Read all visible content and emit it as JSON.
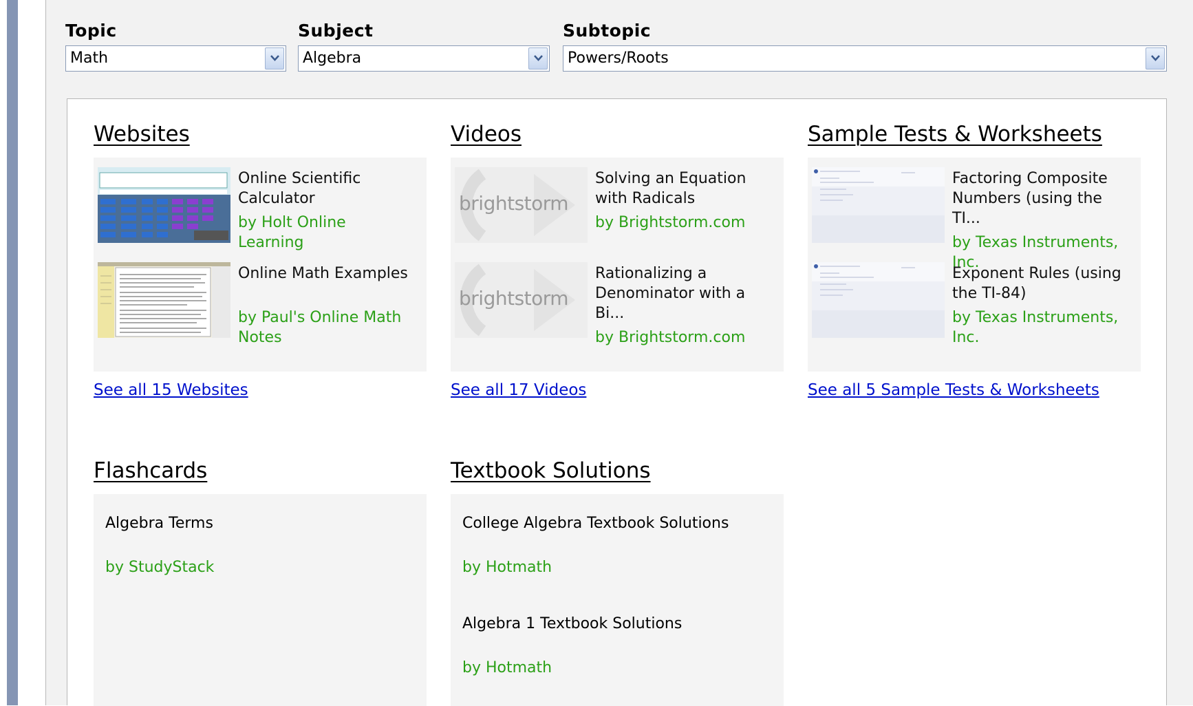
{
  "filters": {
    "topic": {
      "label": "Topic",
      "value": "Math"
    },
    "subject": {
      "label": "Subject",
      "value": "Algebra"
    },
    "subtopic": {
      "label": "Subtopic",
      "value": "Powers/Roots"
    }
  },
  "websites": {
    "title": "Websites",
    "items": [
      {
        "title": "Online Scientific Calculator",
        "author": "by Holt Online Learning"
      },
      {
        "title": "Online Math Examples",
        "author": "by Paul's Online Math Notes"
      }
    ],
    "see_all": "See all 15 Websites"
  },
  "videos": {
    "title": "Videos",
    "items": [
      {
        "title": "Solving an Equation with Radicals",
        "author": "by Brightstorm.com",
        "thumb_text": "brightstorm"
      },
      {
        "title": "Rationalizing a Denominator with a Bi...",
        "author": "by Brightstorm.com",
        "thumb_text": "brightstorm"
      }
    ],
    "see_all": "See all 17 Videos"
  },
  "tests": {
    "title": "Sample Tests & Worksheets",
    "items": [
      {
        "title": "Factoring Composite Numbers (using the TI...",
        "author": "by Texas Instruments, Inc."
      },
      {
        "title": "Exponent Rules (using the TI-84)",
        "author": "by Texas Instruments, Inc."
      }
    ],
    "see_all": "See all 5 Sample Tests & Worksheets"
  },
  "flashcards": {
    "title": "Flashcards",
    "items": [
      {
        "title": "Algebra Terms",
        "author": "by StudyStack"
      }
    ]
  },
  "textbooks": {
    "title": "Textbook Solutions",
    "items": [
      {
        "title": "College Algebra Textbook Solutions",
        "author": "by Hotmath"
      },
      {
        "title": "Algebra 1 Textbook Solutions",
        "author": "by Hotmath"
      }
    ]
  },
  "colors": {
    "author_green": "#2ba017",
    "link_blue": "#0011cc",
    "sidebar": "#8595b4"
  }
}
